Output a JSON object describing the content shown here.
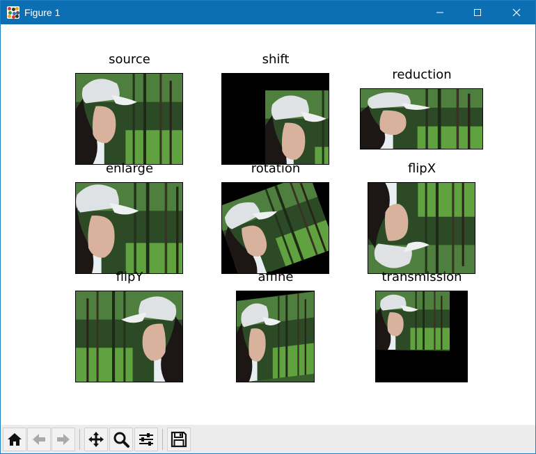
{
  "window": {
    "title": "Figure 1",
    "controls": [
      "minimize",
      "maximize",
      "close"
    ]
  },
  "figure": {
    "subplots": [
      {
        "title": "source",
        "image": "source"
      },
      {
        "title": "shift",
        "image": "shift"
      },
      {
        "title": "reduction",
        "image": "reduction"
      },
      {
        "title": "enlarge",
        "image": "enlarge"
      },
      {
        "title": "rotation",
        "image": "rotation"
      },
      {
        "title": "flipX",
        "image": "flipX"
      },
      {
        "title": "flipY",
        "image": "flipY"
      },
      {
        "title": "affine",
        "image": "affine"
      },
      {
        "title": "transmission",
        "image": "transmission"
      }
    ]
  },
  "toolbar": {
    "buttons": [
      {
        "name": "home",
        "icon": "home-icon"
      },
      {
        "name": "back",
        "icon": "arrow-left-icon"
      },
      {
        "name": "forward",
        "icon": "arrow-right-icon"
      },
      {
        "name": "pan",
        "icon": "move-icon"
      },
      {
        "name": "zoom",
        "icon": "magnifier-icon"
      },
      {
        "name": "configure-subplots",
        "icon": "sliders-icon"
      },
      {
        "name": "save",
        "icon": "floppy-disk-icon"
      }
    ]
  },
  "colors": {
    "titlebar": "#0c6fb3",
    "toolbar": "#ececec",
    "photo_green": "#3f7a35",
    "photo_dark": "#24351f"
  }
}
